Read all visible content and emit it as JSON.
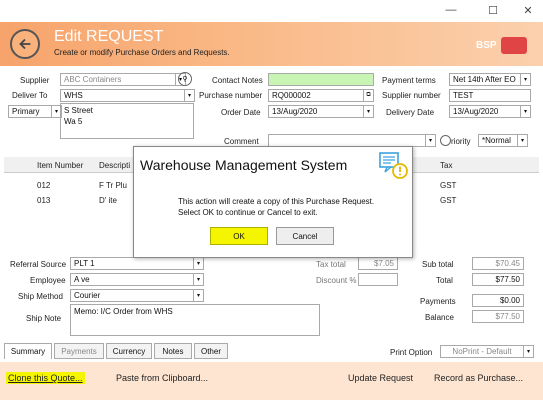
{
  "window": {
    "minimize": "—",
    "maximize": "☐",
    "close": "✕"
  },
  "header": {
    "title": "Edit REQUEST",
    "subtitle": "Create or modify Purchase Orders and Requests.",
    "brand": "BSP"
  },
  "form": {
    "supplier_label": "Supplier",
    "supplier_value": "ABC Containers",
    "deliver_to_label": "Deliver To",
    "deliver_to_value": "WHS",
    "address_type": "Primary",
    "address_line1": "S         Street",
    "address_line2": "Wa            5",
    "contact_notes_label": "Contact Notes",
    "contact_notes_value": "",
    "purchase_number_label": "Purchase number",
    "purchase_number_value": "RQ000002",
    "order_date_label": "Order Date",
    "order_date_value": "13/Aug/2020",
    "payment_terms_label": "Payment terms",
    "payment_terms_value": "Net 14th After EO",
    "supplier_number_label": "Supplier number",
    "supplier_number_value": "TEST",
    "delivery_date_label": "Delivery Date",
    "delivery_date_value": "13/Aug/2020",
    "comment_label": "Comment",
    "comment_value": "",
    "priority_label": "riority",
    "priority_value": "*Normal"
  },
  "grid": {
    "headers": [
      "Item Number",
      "Descripti",
      "Tax"
    ],
    "rows": [
      {
        "item": "012",
        "desc": "F  Tr  Plu",
        "tax": "GST"
      },
      {
        "item": "013",
        "desc": "D'  ite",
        "tax": "GST"
      }
    ]
  },
  "lower": {
    "referral_source_label": "Referral Source",
    "referral_source_value": "PLT 1",
    "employee_label": "Employee",
    "employee_value": "A           ve",
    "ship_method_label": "Ship Method",
    "ship_method_value": "Courier",
    "ship_note_label": "Ship Note",
    "ship_note_value": "Memo: I/C            Order from WHS",
    "tax_total_label": "Tax total",
    "tax_total_value": "$7.05",
    "discount_label": "Discount %",
    "discount_value": "",
    "sub_total_label": "Sub total",
    "sub_total_value": "$70.45",
    "total_label": "Total",
    "total_value": "$77.50",
    "payments_label": "Payments",
    "payments_value": "$0.00",
    "balance_label": "Balance",
    "balance_value": "$77.50"
  },
  "tabs": [
    "Summary",
    "Payments",
    "Currency",
    "Notes",
    "Other"
  ],
  "print": {
    "label": "Print Option",
    "value": "NoPrint - Default"
  },
  "bottom": {
    "clone": "Clone this Quote...",
    "paste": "Paste from Clipboard...",
    "update": "Update Request",
    "record": "Record as Purchase..."
  },
  "dialog": {
    "title": "Warehouse Management System",
    "message1": "This action will create a copy of this Purchase Request.",
    "message2": "Select OK to continue or Cancel to exit.",
    "ok": "OK",
    "cancel": "Cancel"
  },
  "colors": {
    "header": "#f7a36b",
    "highlight": "#f5f500",
    "contact_notes": "#c9f5b4",
    "bottombar": "#fde5d2"
  }
}
